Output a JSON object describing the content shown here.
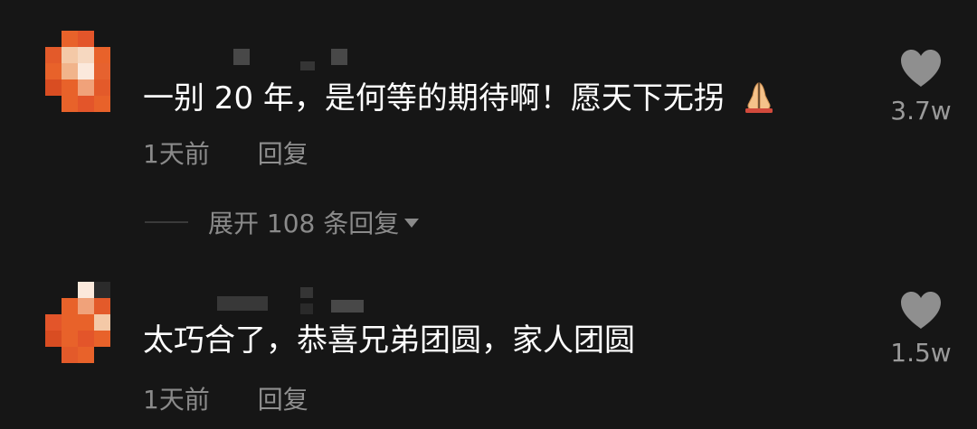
{
  "comments": [
    {
      "text": "一别 20 年，是何等的期待啊！愿天下无拐",
      "emoji": "folded-hands",
      "time": "1天前",
      "reply_label": "回复",
      "likes": "3.7w",
      "expand_label": "展开 108 条回复"
    },
    {
      "text": "太巧合了，恭喜兄弟团圆，家人团圆",
      "time": "1天前",
      "reply_label": "回复",
      "likes": "1.5w"
    }
  ],
  "colors": {
    "background": "#161616",
    "text": "#ffffff",
    "meta": "#8a8a8a",
    "heart": "#8f8f8f",
    "avatar_accent": "#e8622a"
  },
  "icons": {
    "like": "heart-icon",
    "expand": "caret-down-icon"
  }
}
